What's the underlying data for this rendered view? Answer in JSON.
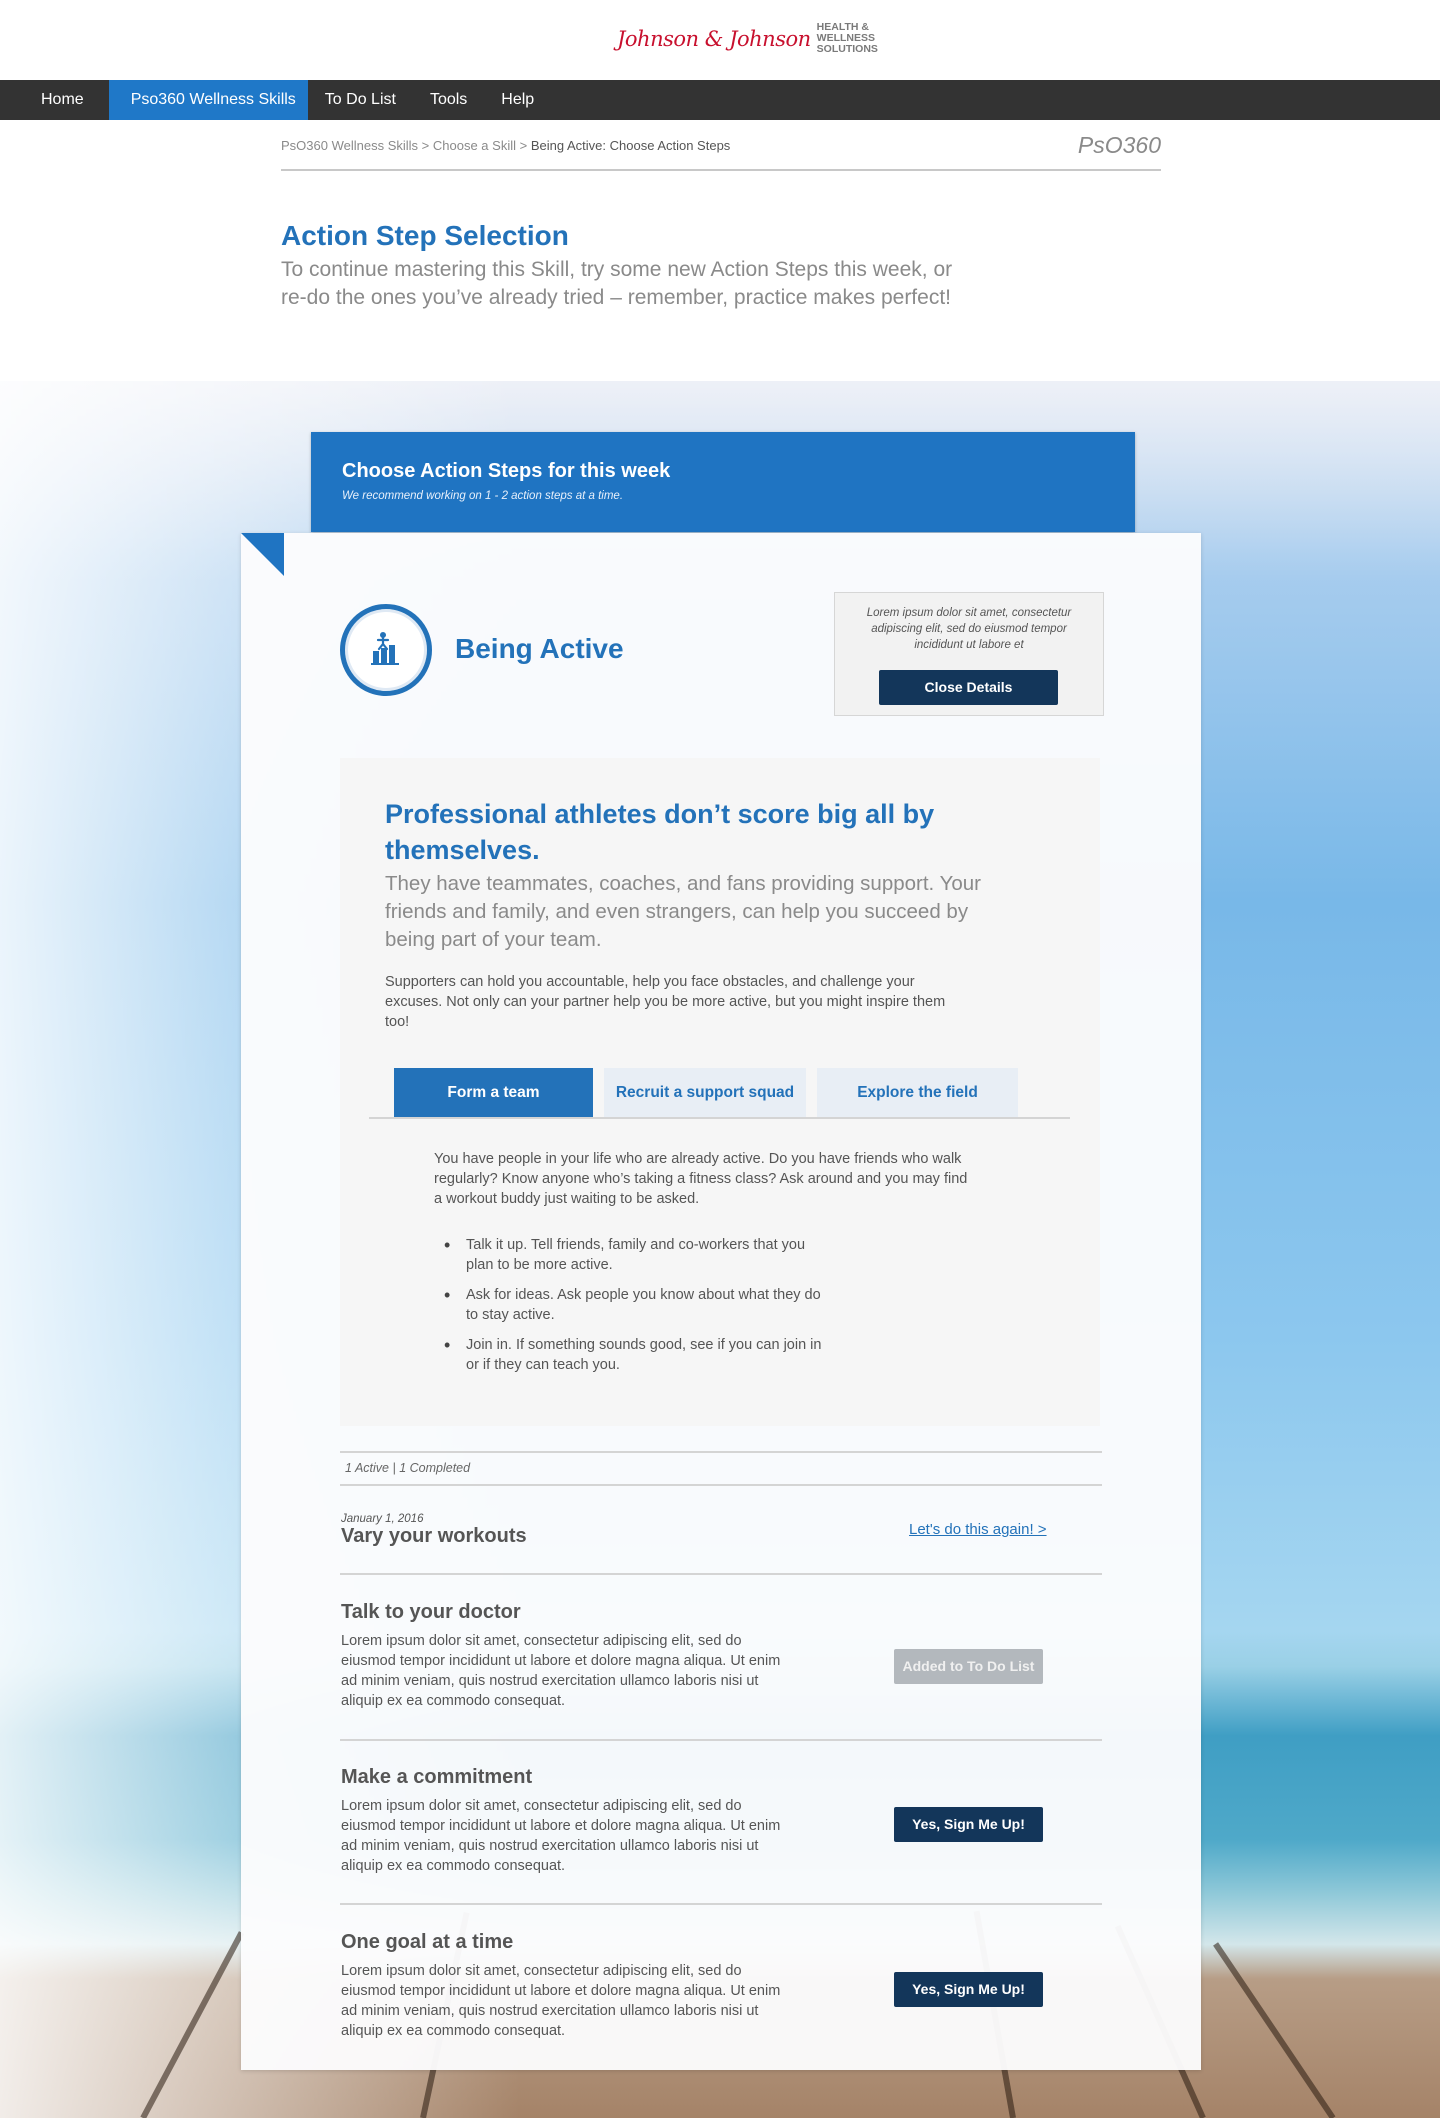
{
  "brand": {
    "logo_script": "Johnson & Johnson",
    "logo_sub_lines": [
      "HEALTH &",
      "WELLNESS",
      "SOLUTIONS"
    ],
    "mark": "PsO360"
  },
  "nav": {
    "items": [
      {
        "label": "Home",
        "active": false
      },
      {
        "label": "Pso360 Wellness Skills",
        "active": true
      },
      {
        "label": "To Do List",
        "active": false
      },
      {
        "label": "Tools",
        "active": false
      },
      {
        "label": "Help",
        "active": false
      }
    ]
  },
  "breadcrumb": {
    "items": [
      "PsO360 Wellness Skills",
      "Choose a Skill"
    ],
    "separator": ">",
    "current": "Being Active: Choose Action Steps"
  },
  "page": {
    "title": "Action Step Selection",
    "intro": "To continue mastering this Skill, try some new Action Steps this week, or re-do the ones you’ve already tried – remember, practice makes perfect!"
  },
  "choose": {
    "title": "Choose Action Steps for this week",
    "subtitle": "We recommend working on 1 - 2 action steps at a time."
  },
  "skill": {
    "name": "Being Active",
    "icon": "chart-person-icon",
    "details_text": "Lorem ipsum dolor sit amet, consectetur adipiscing elit, sed do eiusmod tempor incididunt ut labore et",
    "close_details_label": "Close Details"
  },
  "panel": {
    "heading": "Professional athletes don’t score big all by themselves.",
    "lead": "They have teammates, coaches, and fans providing support. Your friends and family, and even strangers, can help you succeed by being part of your team.",
    "body": "Supporters can hold you accountable, help you face obstacles, and challenge your excuses. Not only can your partner help you be more active, but you might inspire them too!",
    "tabs": [
      {
        "label": "Form a team",
        "active": true
      },
      {
        "label": "Recruit a support squad",
        "active": false
      },
      {
        "label": "Explore the field",
        "active": false
      }
    ],
    "tab_content": "You have people in your life who are already active. Do you have friends who walk regularly? Know anyone who’s taking a fitness class? Ask around and you may find a workout buddy just waiting to be asked.",
    "tab_list": [
      "Talk it up. Tell friends, family and co-workers that you plan to be more active.",
      "Ask for ideas. Ask people you know about what they do to stay active.",
      "Join in. If something sounds good, see if you can join in or if they can teach you."
    ]
  },
  "status": {
    "text": "1 Active  |  1 Completed"
  },
  "completed": {
    "date": "January 1, 2016",
    "title": "Vary your workouts",
    "link": "Let's do this again! >"
  },
  "steps": [
    {
      "title": "Talk to your doctor",
      "desc": "Lorem ipsum dolor sit amet, consectetur adipiscing elit, sed do eiusmod tempor incididunt ut labore et dolore magna aliqua. Ut enim ad minim veniam, quis nostrud exercitation ullamco laboris nisi ut aliquip ex ea commodo consequat.",
      "button": "Added to To Do List",
      "state": "added"
    },
    {
      "title": "Make a commitment",
      "desc": "Lorem ipsum dolor sit amet, consectetur adipiscing elit, sed do eiusmod tempor incididunt ut labore et dolore magna aliqua. Ut enim ad minim veniam, quis nostrud exercitation ullamco laboris nisi ut aliquip ex ea commodo consequat.",
      "button": "Yes, Sign Me Up!",
      "state": "signup"
    },
    {
      "title": "One goal at a time",
      "desc": "Lorem ipsum dolor sit amet, consectetur adipiscing elit, sed do eiusmod tempor incididunt ut labore et dolore magna aliqua. Ut enim ad minim veniam, quis nostrud exercitation ullamco laboris nisi ut aliquip ex ea commodo consequat.",
      "button": "Yes, Sign Me Up!",
      "state": "signup"
    }
  ],
  "colors": {
    "brand_blue": "#2372b9",
    "nav_dark": "#333333",
    "button_navy": "#13365a",
    "button_disabled": "#b3b8bd",
    "logo_red": "#c8102e"
  }
}
